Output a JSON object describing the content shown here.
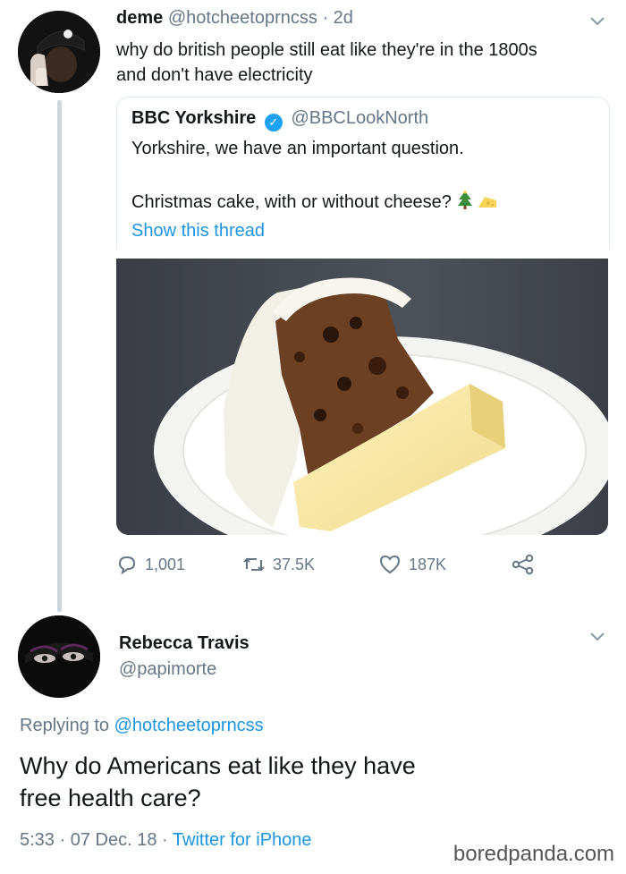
{
  "tweet": {
    "display_name": "deme",
    "handle": "@hotcheetoprncss",
    "age": "2d",
    "text_line1": "why do british people still eat like they're in the 1800s",
    "text_line2": "and don't have electricity"
  },
  "quoted": {
    "display_name": "BBC Yorkshire",
    "handle": "@BBCLookNorth",
    "line1": "Yorkshire, we have an important question.",
    "line2": "Christmas cake, with or without cheese?",
    "show_thread": "Show this thread"
  },
  "actions": {
    "replies": "1,001",
    "retweets": "37.5K",
    "likes": "187K"
  },
  "reply": {
    "display_name": "Rebecca Travis",
    "handle": "@papimorte",
    "replying_to_prefix": "Replying to",
    "replying_to_handle": "@hotcheetoprncss",
    "text_line1": "Why do Americans eat like they have",
    "text_line2": "free health care?",
    "time": "5:33",
    "date": "07 Dec. 18",
    "client": "Twitter for iPhone"
  },
  "watermark": "boredpanda.com",
  "colors": {
    "accent": "#1b95e0",
    "muted": "#657786",
    "verified": "#1da1f2",
    "thread_line": "#ccd6dd"
  },
  "icons": [
    "chevron-down-icon",
    "verified-icon",
    "reply-icon",
    "retweet-icon",
    "like-icon",
    "share-icon",
    "christmas-tree-icon",
    "cheese-icon"
  ]
}
